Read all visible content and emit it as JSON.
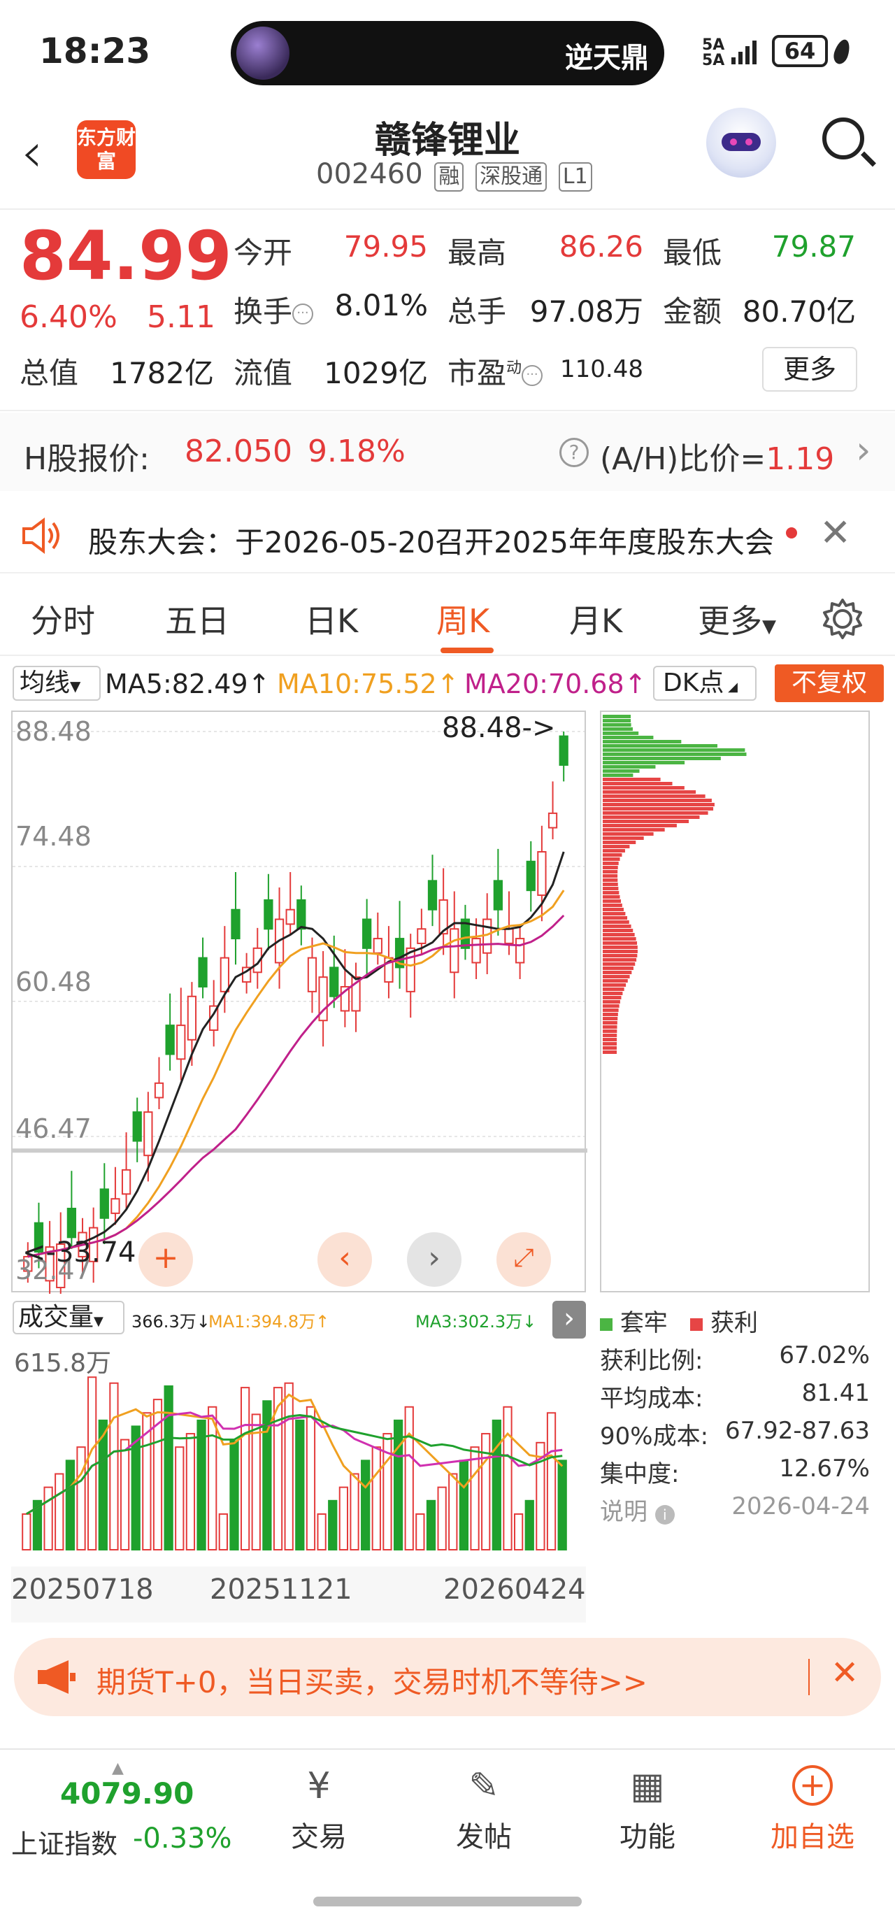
{
  "status": {
    "time": "18:23",
    "live_title": "逆天鼎",
    "signal": "5A",
    "battery": "64"
  },
  "header": {
    "stock_name": "赣锋锂业",
    "code": "002460",
    "tags": [
      "融",
      "深股通",
      "L1"
    ],
    "logo_text": "东方财富"
  },
  "quote": {
    "price": "84.99",
    "pct": "6.40%",
    "change": "5.11",
    "open_label": "今开",
    "open": "79.95",
    "high_label": "最高",
    "high": "86.26",
    "low_label": "最低",
    "low": "79.87",
    "turnover_label": "换手",
    "turnover": "8.01%",
    "volume_label": "总手",
    "volume": "97.08万",
    "amount_label": "金额",
    "amount": "80.70亿",
    "mcap_label": "总值",
    "mcap": "1782亿",
    "float_label": "流值",
    "float": "1029亿",
    "pe_label": "市盈",
    "pe_sup": "动",
    "pe": "110.48",
    "more": "更多"
  },
  "hshare": {
    "label": "H股报价:",
    "price": "82.050",
    "pct": "9.18%",
    "ah_label": "(A/H)比价=",
    "ah_value": "1.19"
  },
  "announce": {
    "text": "股东大会：于2026-05-20召开2025年年度股东大会"
  },
  "tabs": [
    "分时",
    "五日",
    "日K",
    "周K",
    "月K",
    "更多"
  ],
  "ma": {
    "selector": "均线",
    "ma5": "MA5:82.49↑",
    "ma10": "MA10:75.52↑",
    "ma20": "MA20:70.68↑",
    "dk": "DK点",
    "fq": "不复权"
  },
  "chart": {
    "y_labels": [
      "88.48",
      "74.48",
      "60.48",
      "46.47",
      "32.47"
    ],
    "max_label": "88.48->",
    "min_label": "<-33.74",
    "colors": {
      "up": "#e43a3a",
      "down": "#1fa12d",
      "ma5": "#222222",
      "ma10": "#f0a020",
      "ma20": "#c0208a"
    }
  },
  "volume": {
    "selector": "成交量",
    "v1": "366.3万↓",
    "ma1": "MA1:394.8万↑",
    "ma3": "MA3:302.3万↓",
    "top_label": "615.8万"
  },
  "dates": [
    "20250718",
    "20251121",
    "20260424"
  ],
  "chips": {
    "legend_trapped": "套牢",
    "legend_profit": "获利",
    "rows": [
      {
        "label": "获利比例:",
        "value": "67.02%"
      },
      {
        "label": "平均成本:",
        "value": "81.41"
      },
      {
        "label": "90%成本:",
        "value": "67.92-87.63"
      },
      {
        "label": "集中度:",
        "value": "12.67%"
      },
      {
        "label": "说明",
        "value": "2026-04-24"
      }
    ]
  },
  "ad": {
    "text": "期货T+0，当日买卖，交易时机不等待>>"
  },
  "bottom": {
    "index_value": "4079.90",
    "index_name": "上证指数",
    "index_pct": "-0.33%",
    "items": [
      "交易",
      "发帖",
      "功能",
      "加自选"
    ]
  }
}
